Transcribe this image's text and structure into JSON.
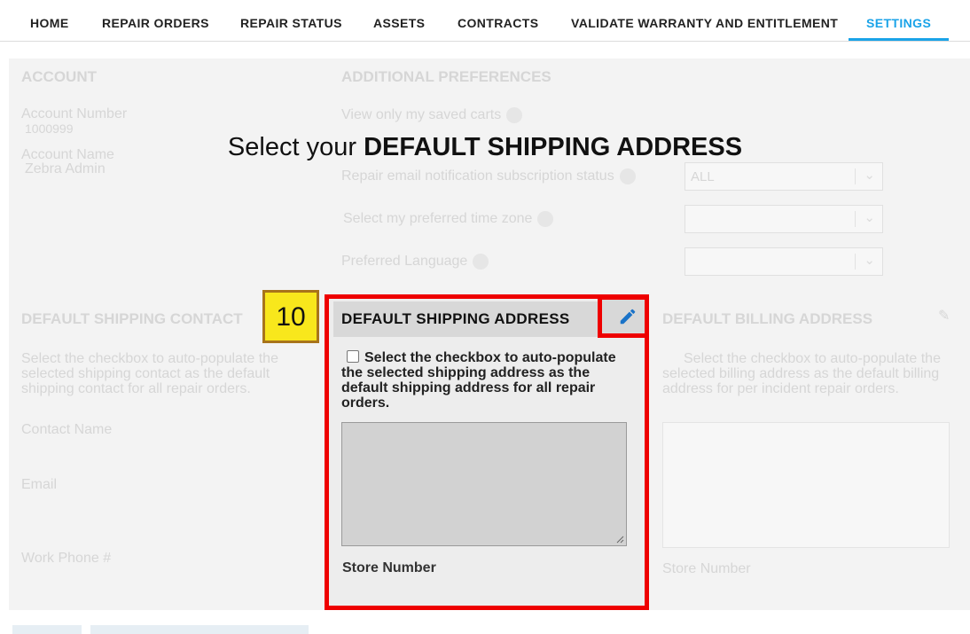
{
  "nav": {
    "items": [
      {
        "label": "HOME"
      },
      {
        "label": "REPAIR ORDERS"
      },
      {
        "label": "REPAIR STATUS"
      },
      {
        "label": "ASSETS"
      },
      {
        "label": "CONTRACTS"
      },
      {
        "label": "VALIDATE WARRANTY AND ENTITLEMENT"
      },
      {
        "label": "SETTINGS",
        "active": true
      }
    ]
  },
  "heading": {
    "prefix": "Select your ",
    "emphasis": "DEFAULT SHIPPING ADDRESS"
  },
  "callout": {
    "number": "10"
  },
  "background": {
    "account": {
      "title": "ACCOUNT",
      "number_label": "Account Number",
      "number_value": "1000999",
      "name_label": "Account Name",
      "name_value": "Zebra Admin"
    },
    "preferences": {
      "title": "ADDITIONAL PREFERENCES",
      "saved_carts_label": "View only my saved carts",
      "email_label": "Repair email notification subscription status",
      "email_value": "ALL",
      "timezone_label": "Select my preferred time zone",
      "language_label": "Preferred Language"
    },
    "shipping_contact": {
      "title": "DEFAULT SHIPPING CONTACT",
      "note": "Select the checkbox to auto-populate the selected shipping contact as the default shipping contact for all repair orders.",
      "contact_name_label": "Contact Name",
      "email_label": "Email",
      "work_phone_label": "Work Phone #"
    },
    "billing": {
      "title": "DEFAULT BILLING ADDRESS",
      "note": "Select the checkbox to auto-populate the selected billing address as the default billing address for per incident repair orders.",
      "store_label": "Store Number"
    }
  },
  "shipping_address": {
    "title": "DEFAULT SHIPPING ADDRESS",
    "note": "Select the checkbox to auto-populate the selected shipping address as the default shipping address for all repair orders.",
    "address_value": "",
    "store_label": "Store Number",
    "edit_icon": "pencil-icon"
  },
  "colors": {
    "accent": "#1aa3e8",
    "highlight": "#ee0000",
    "callout_bg": "#f8e71c"
  }
}
